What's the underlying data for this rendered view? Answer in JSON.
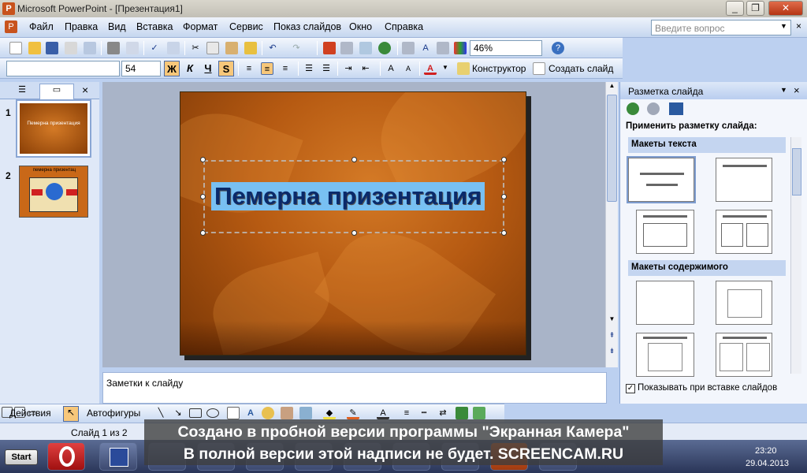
{
  "window": {
    "title": "Microsoft PowerPoint - [Презентация1]",
    "minimize": "_",
    "restore": "❐",
    "close": "✕"
  },
  "menu": {
    "items": [
      "Файл",
      "Правка",
      "Вид",
      "Вставка",
      "Формат",
      "Сервис",
      "Показ слайдов",
      "Окно",
      "Справка"
    ],
    "help_placeholder": "Введите вопрос",
    "close_doc": "×"
  },
  "toolbar": {
    "zoom": "46%",
    "font_size": "54",
    "bold": "Ж",
    "italic": "К",
    "underline": "Ч",
    "shadow": "S",
    "font_color": "A",
    "designer": "Конструктор",
    "new_slide": "Создать слайд"
  },
  "left_pane": {
    "slide1_num": "1",
    "slide1_text": "Пемерна призентация",
    "slide2_num": "2",
    "slide2_text": "пемерна призентац"
  },
  "slide": {
    "title": "Пемерна призентация"
  },
  "notes": {
    "placeholder": "Заметки к слайду"
  },
  "taskpane": {
    "title": "Разметка слайда",
    "apply_label": "Применить разметку слайда:",
    "section_text": "Макеты текста",
    "section_content": "Макеты содержимого",
    "show_on_insert": "Показывать при вставке слайдов"
  },
  "drawbar": {
    "actions": "Действия",
    "autoshapes": "Автофигуры"
  },
  "status": {
    "slide_counter": "Слайд 1 из 2"
  },
  "taskbar": {
    "start": "Start",
    "time": "23:20",
    "date": "29.04.2013"
  },
  "watermark": {
    "line1": "Создано в пробной версии программы \"Экранная Камера\"",
    "line2": "В полной версии этой надписи не будет. SCREENCAM.RU"
  },
  "colors": {
    "slide_bg": "#b65a12",
    "title_highlight": "#78c0f2",
    "title_text": "#0a2a6a",
    "ui_blue": "#c5d6ef"
  }
}
